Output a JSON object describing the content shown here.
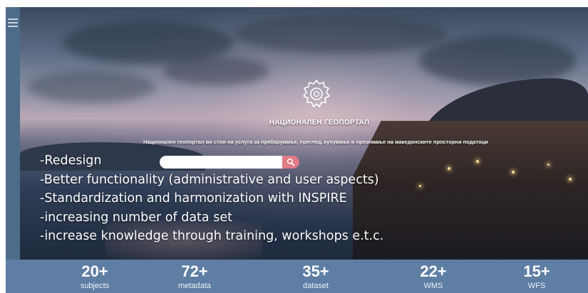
{
  "header": {
    "title": "НАЦИОНАЛЕН ГЕОПОРТАЛ",
    "subtitle": "Национален геопортал ви стои на услуга за пребарување, преглед, купување и преземање на македонските просторни податоци",
    "logo_icon": "gear-emblem-icon"
  },
  "search": {
    "value": "",
    "button_icon": "search-icon",
    "button_color": "#e07a85"
  },
  "bullets": [
    "-Redesign",
    "-Better functionality (administrative and user aspects)",
    "-Standardization and harmonization with INSPIRE",
    "-increasing number of data set",
    "-increase knowledge through training, workshops  e.t.c."
  ],
  "stats": [
    {
      "value": "20+",
      "label": "subjects"
    },
    {
      "value": "72+",
      "label": "metadata"
    },
    {
      "value": "35+",
      "label": "dataset"
    },
    {
      "value": "22+",
      "label": "WMS"
    },
    {
      "value": "15+",
      "label": "WFS"
    }
  ],
  "sidebar": {
    "menu_icon": "hamburger-menu-icon",
    "bottom_icons": [
      "globe-icon",
      "search-icon",
      "map-icon"
    ]
  },
  "colors": {
    "rail": "#4d6c8a",
    "stats_bar": "#5e7ea3"
  }
}
